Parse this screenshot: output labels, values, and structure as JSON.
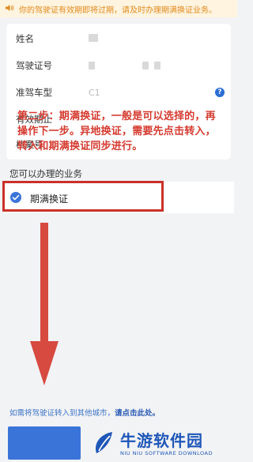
{
  "notice": {
    "icon": "speaker-icon",
    "text": "你的驾驶证有效期即将过期，请及时办理期满换证业务。"
  },
  "info_card": {
    "rows": [
      {
        "label": "姓名",
        "value": ""
      },
      {
        "label": "驾驶证号",
        "value": ""
      },
      {
        "label": "准驾车型",
        "value": "C1"
      },
      {
        "label": "有效期止",
        "value": ""
      },
      {
        "label": "档案号",
        "value": ""
      }
    ]
  },
  "annotation": {
    "text": "第二步：期满换证，一般是可以选择的，再操作下一步。异地换证，需要先点击转入，转入和期满换证同步进行。",
    "color": "#d53a2f"
  },
  "business": {
    "section_title": "您可以办理的业务",
    "option_label": "期满换证",
    "option_checked": true
  },
  "transfer": {
    "text": "如需将驾驶证转入到其他城市，",
    "link": "请点击此处。"
  },
  "watermark": {
    "name": "牛游软件园",
    "subtitle": "NIU NIU SOFTWARE DOWNLOAD",
    "logo": "leaf-logo-icon"
  },
  "colors": {
    "accent": "#3a74d8",
    "notice_bg": "#fff4df",
    "notice_text": "#e08a1e",
    "highlight": "#c9312a"
  }
}
